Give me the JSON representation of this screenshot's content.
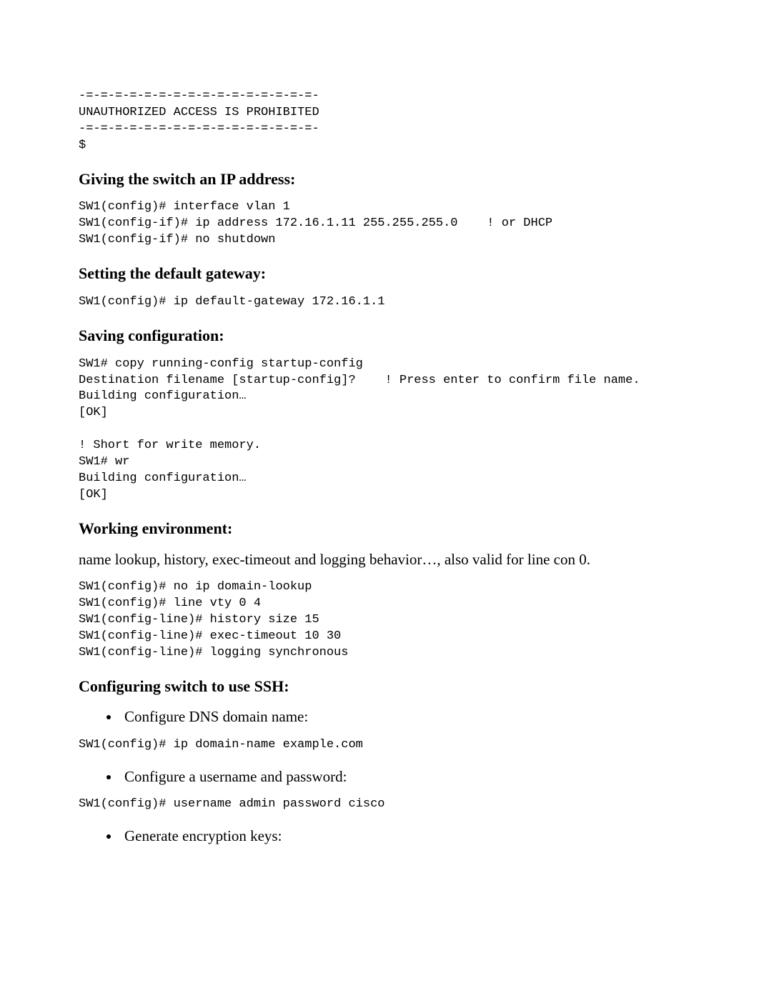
{
  "pre_banner": "-=-=-=-=-=-=-=-=-=-=-=-=-=-=-=-=-\nUNAUTHORIZED ACCESS IS PROHIBITED\n-=-=-=-=-=-=-=-=-=-=-=-=-=-=-=-=-\n$",
  "sec_ip": {
    "heading": "Giving the switch an IP address:",
    "code": "SW1(config)# interface vlan 1\nSW1(config-if)# ip address 172.16.1.11 255.255.255.0    ! or DHCP\nSW1(config-if)# no shutdown"
  },
  "sec_gateway": {
    "heading": "Setting the default gateway:",
    "code": "SW1(config)# ip default-gateway 172.16.1.1"
  },
  "sec_saving": {
    "heading": "Saving configuration:",
    "code": "SW1# copy running-config startup-config\nDestination filename [startup-config]?    ! Press enter to confirm file name.\nBuilding configuration…\n[OK]\n\n! Short for write memory.\nSW1# wr\nBuilding configuration…\n[OK]"
  },
  "sec_working": {
    "heading": "Working environment:",
    "body": "name lookup, history, exec-timeout and logging behavior…, also valid for line con 0.",
    "code": "SW1(config)# no ip domain-lookup\nSW1(config)# line vty 0 4\nSW1(config-line)# history size 15\nSW1(config-line)# exec-timeout 10 30\nSW1(config-line)# logging synchronous"
  },
  "sec_ssh": {
    "heading": "Configuring switch to use SSH:",
    "b1": "Configure DNS domain name:",
    "c1": "SW1(config)# ip domain-name example.com",
    "b2": "Configure a username and password:",
    "c2": "SW1(config)# username admin password cisco",
    "b3": "Generate encryption keys:"
  }
}
